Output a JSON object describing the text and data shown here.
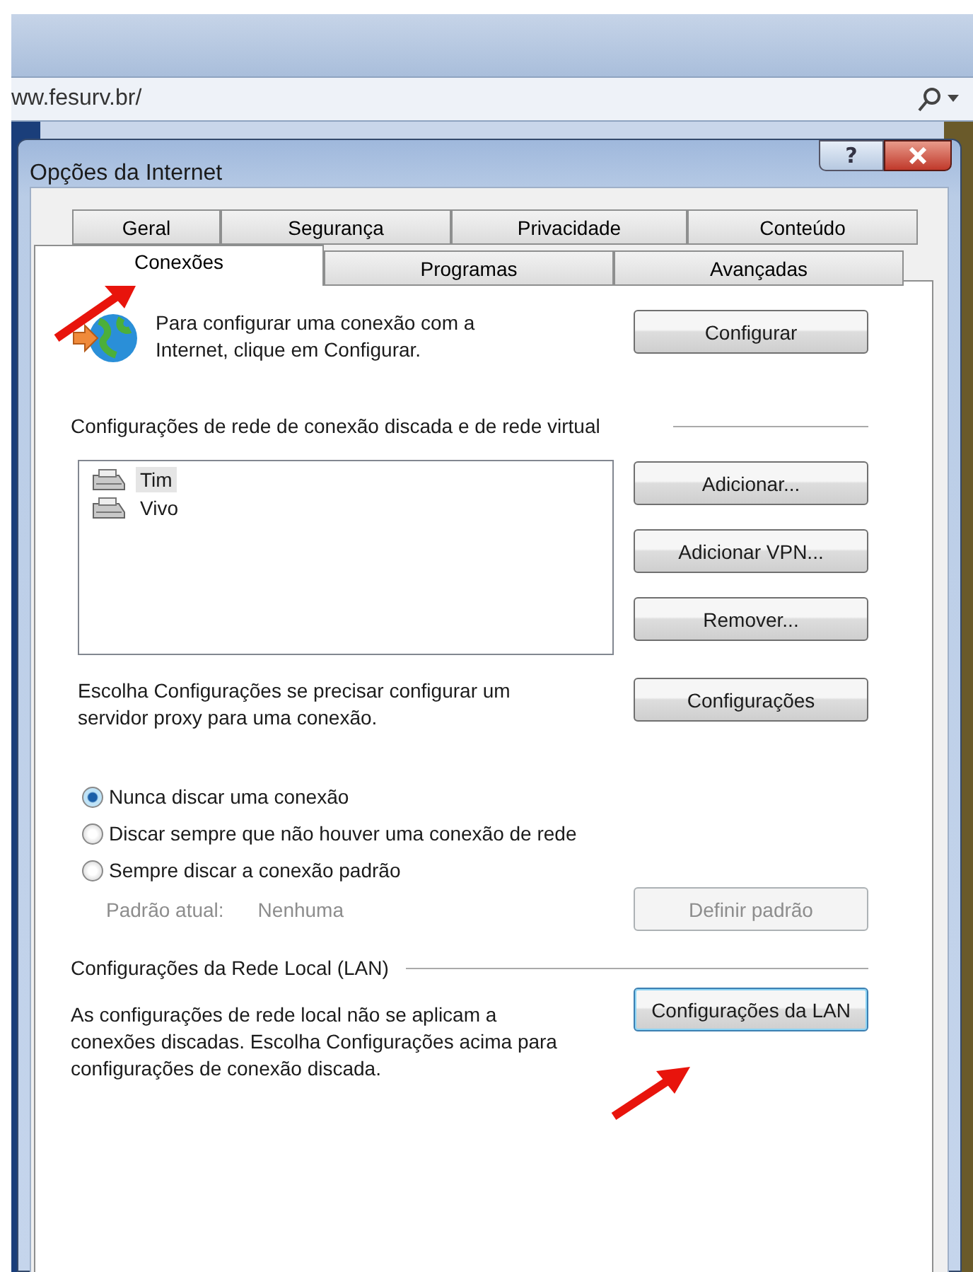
{
  "browser": {
    "address": "ww.fesurv.br/"
  },
  "dialog": {
    "title": "Opções da Internet",
    "help_label": "?"
  },
  "tabs": [
    [
      {
        "label": "Geral",
        "selected": false
      },
      {
        "label": "Segurança",
        "selected": false
      },
      {
        "label": "Privacidade",
        "selected": false
      },
      {
        "label": "Conteúdo",
        "selected": false
      }
    ],
    [
      {
        "label": "Conexões",
        "selected": true
      },
      {
        "label": "Programas",
        "selected": false
      },
      {
        "label": "Avançadas",
        "selected": false
      }
    ]
  ],
  "setup": {
    "text": "Para configurar uma conexão com a Internet, clique em Configurar.",
    "button": "Configurar"
  },
  "dialup": {
    "heading": "Configurações de rede de conexão discada e de rede virtual",
    "connections": [
      {
        "name": "Tim",
        "selected": true
      },
      {
        "name": "Vivo",
        "selected": false
      }
    ],
    "buttons": [
      "Adicionar...",
      "Adicionar VPN...",
      "Remover..."
    ]
  },
  "proxy": {
    "text": "Escolha Configurações se precisar configurar um servidor proxy para uma conexão.",
    "button": "Configurações"
  },
  "dial_options": [
    {
      "label": "Nunca discar uma conexão",
      "selected": true
    },
    {
      "label": "Discar sempre que não houver uma conexão de rede",
      "selected": false
    },
    {
      "label": "Sempre discar a conexão padrão",
      "selected": false
    }
  ],
  "current_default": {
    "label": "Padrão atual:",
    "value": "Nenhuma",
    "button": {
      "label": "Definir padrão",
      "disabled": true
    }
  },
  "lan": {
    "heading": "Configurações da Rede Local (LAN)",
    "text": "As configurações de rede local não se aplicam a conexões discadas. Escolha Configurações acima para configurações de conexão discada.",
    "button": {
      "label": "Configurações da LAN",
      "focused": true
    }
  }
}
